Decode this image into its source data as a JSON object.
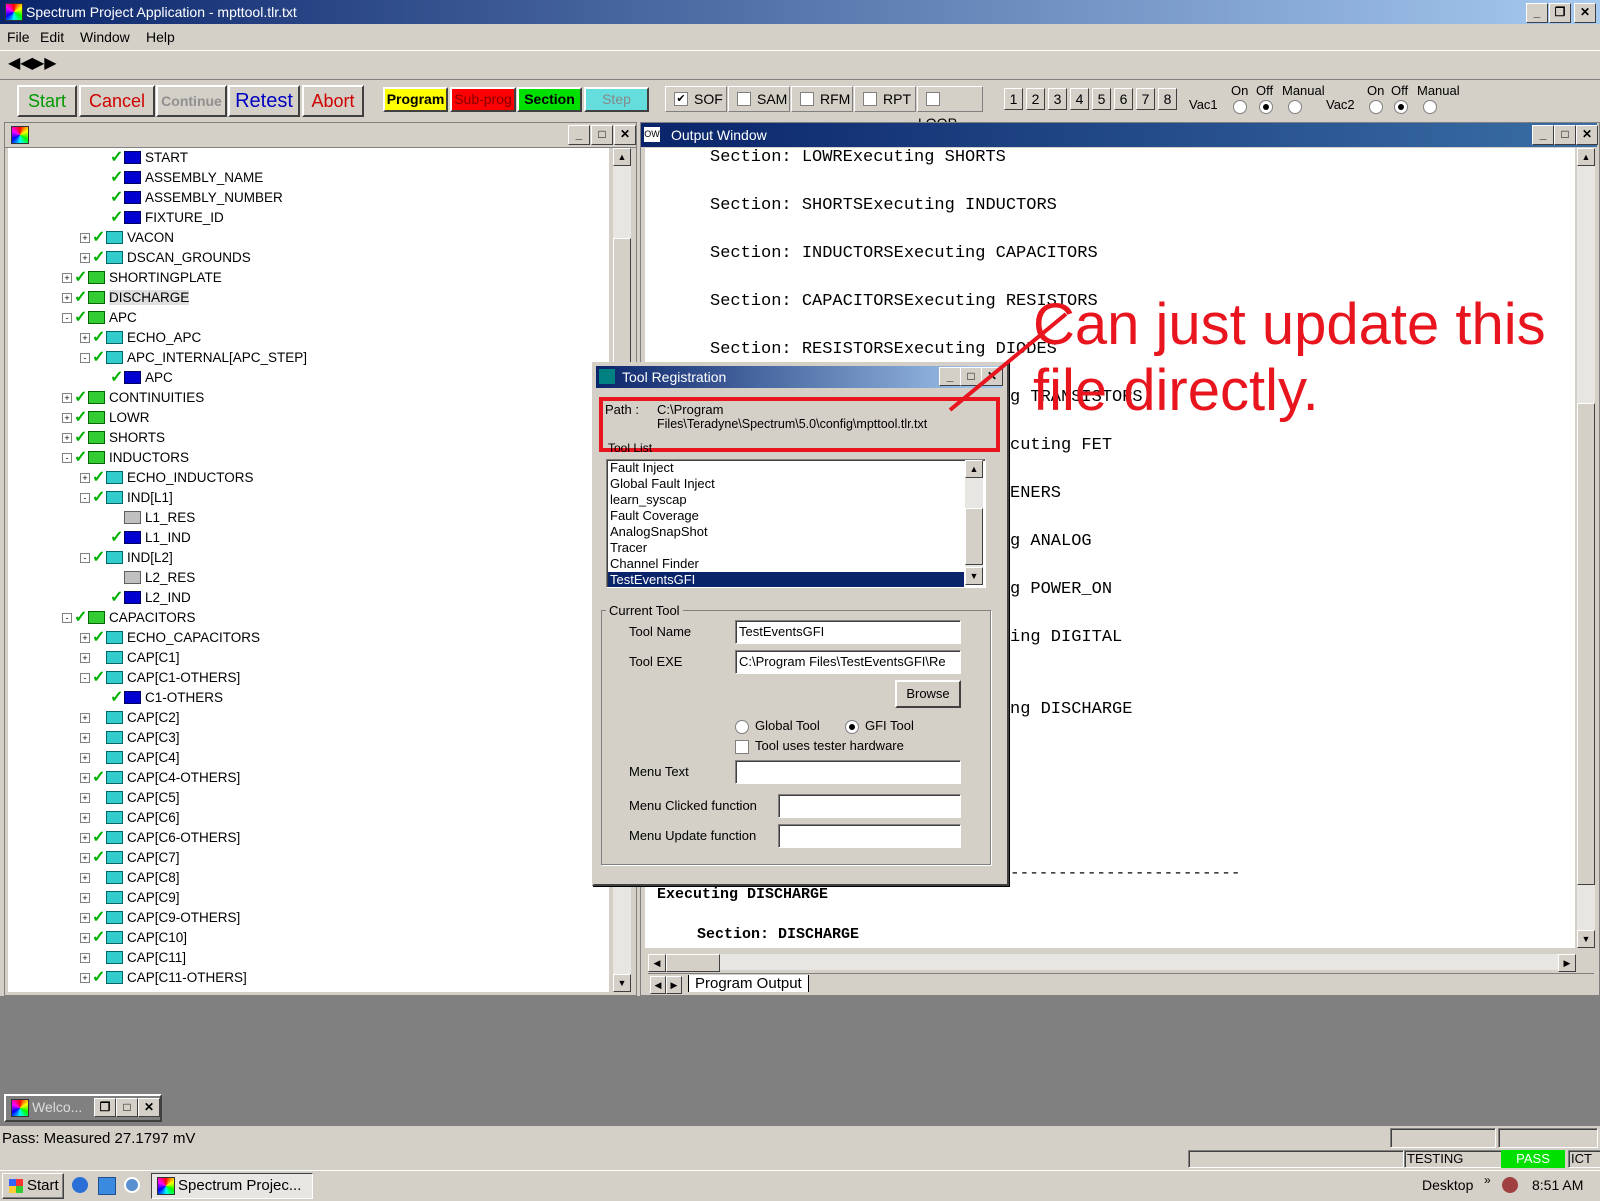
{
  "window": {
    "title": "Spectrum Project Application - mpttool.tlr.txt"
  },
  "menu": [
    "File",
    "Edit",
    "Window",
    "Help"
  ],
  "actions": {
    "start": "Start",
    "cancel": "Cancel",
    "continue": "Continue",
    "retest": "Retest",
    "abort": "Abort"
  },
  "modes": {
    "program": "Program",
    "subprog": "Sub-prog",
    "section": "Section",
    "step": "Step"
  },
  "checks": [
    {
      "label": "SOF",
      "checked": true
    },
    {
      "label": "SAM",
      "checked": false
    },
    {
      "label": "RFM",
      "checked": false
    },
    {
      "label": "RPT",
      "checked": false
    },
    {
      "label": "LOOP",
      "checked": false
    }
  ],
  "sites": [
    "1",
    "2",
    "3",
    "4",
    "5",
    "6",
    "7",
    "8"
  ],
  "vac": {
    "vac1": "Vac1",
    "vac2": "Vac2",
    "on": "On",
    "off": "Off",
    "manual": "Manual"
  },
  "tree": [
    "START",
    "ASSEMBLY_NAME",
    "ASSEMBLY_NUMBER",
    "FIXTURE_ID",
    "VACON",
    "DSCAN_GROUNDS",
    "SHORTINGPLATE",
    "DISCHARGE",
    "APC",
    "ECHO_APC",
    "APC_INTERNAL[APC_STEP]",
    "APC",
    "CONTINUITIES",
    "LOWR",
    "SHORTS",
    "INDUCTORS",
    "ECHO_INDUCTORS",
    "IND[L1]",
    "L1_RES",
    "L1_IND",
    "IND[L2]",
    "L2_RES",
    "L2_IND",
    "CAPACITORS",
    "ECHO_CAPACITORS",
    "CAP[C1]",
    "CAP[C1-OTHERS]",
    "C1-OTHERS",
    "CAP[C2]",
    "CAP[C3]",
    "CAP[C4]",
    "CAP[C4-OTHERS]",
    "CAP[C5]",
    "CAP[C6]",
    "CAP[C6-OTHERS]",
    "CAP[C7]",
    "CAP[C8]",
    "CAP[C9]",
    "CAP[C9-OTHERS]",
    "CAP[C10]",
    "CAP[C11]",
    "CAP[C11-OTHERS]"
  ],
  "output_window": {
    "title": "Output Window",
    "lines": [
      "Section: LOWRExecuting SHORTS",
      "Section: SHORTSExecuting INDUCTORS",
      "Section: INDUCTORSExecuting CAPACITORS",
      "Section: CAPACITORSExecuting RESISTORS",
      "Section: RESISTORSExecuting DIODES",
      "g TRANSISTORS",
      "cuting FET",
      "ENERS",
      "g ANALOG",
      "g POWER_ON",
      "ing DIGITAL",
      "ng DISCHARGE"
    ],
    "dashes": "------------------------",
    "exec": "Executing DISCHARGE",
    "section": "Section: DISCHARGE",
    "tab": "Program Output"
  },
  "dialog": {
    "title": "Tool Registration",
    "path_label": "Path :",
    "path_line1": "C:\\Program",
    "path_line2": "Files\\Teradyne\\Spectrum\\5.0\\config\\mpttool.tlr.txt",
    "toollist_label": "Tool List",
    "tools": [
      "Fault Inject",
      "Global Fault Inject",
      "learn_syscap",
      "Fault Coverage",
      "AnalogSnapShot",
      "Tracer",
      "Channel Finder",
      "TestEventsGFI"
    ],
    "current_tool": "Current Tool",
    "tool_name_label": "Tool Name",
    "tool_name": "TestEventsGFI",
    "tool_exe_label": "Tool EXE",
    "tool_exe": "C:\\Program Files\\TestEventsGFI\\Re",
    "browse": "Browse",
    "global_tool": "Global Tool",
    "gfi_tool": "GFI Tool",
    "uses_hw": "Tool uses tester hardware",
    "menu_text": "Menu Text",
    "menu_clicked": "Menu Clicked function",
    "menu_update": "Menu Update function"
  },
  "annotation": "Can just update this\nfile directly.",
  "colors": {
    "annotation": "#e8141e"
  },
  "minimized": "Welco...",
  "status": {
    "message": "Pass: Measured 27.1797 mV",
    "testing": "TESTING",
    "pass": "PASS",
    "ict": "ICT"
  },
  "taskbar": {
    "start": "Start",
    "task": "Spectrum Projec...",
    "desktop": "Desktop",
    "time": "8:51 AM"
  }
}
